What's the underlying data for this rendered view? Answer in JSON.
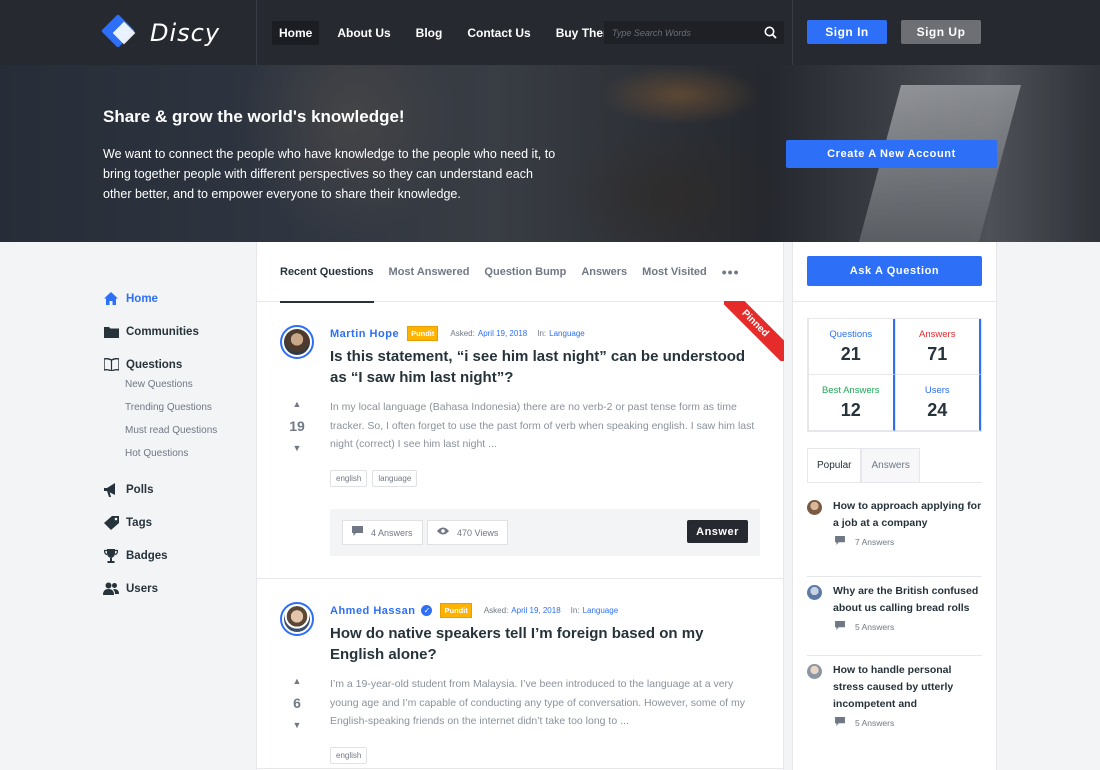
{
  "header": {
    "logo_text": "Discy",
    "nav": [
      "Home",
      "About Us",
      "Blog",
      "Contact Us",
      "Buy Theme"
    ],
    "search_placeholder": "Type Search Words",
    "sign_in": "Sign In",
    "sign_up": "Sign Up"
  },
  "hero": {
    "title": "Share & grow the world's knowledge!",
    "description": "We want to connect the people who have knowledge to the people who need it, to bring together people with different perspectives so they can understand each other better, and to empower everyone to share their knowledge.",
    "cta": "Create A New Account"
  },
  "left_nav": {
    "home": "Home",
    "communities": "Communities",
    "questions": "Questions",
    "sub": [
      "New Questions",
      "Trending Questions",
      "Must read Questions",
      "Hot Questions"
    ],
    "polls": "Polls",
    "tags": "Tags",
    "badges": "Badges",
    "users": "Users"
  },
  "tabs": [
    "Recent Questions",
    "Most Answered",
    "Question Bump",
    "Answers",
    "Most Visited"
  ],
  "tabs_more": "•••",
  "questions": [
    {
      "pinned": "Pinned",
      "author": "Martin Hope",
      "badge": "Pundit",
      "asked_label": "Asked:",
      "date": "April 19, 2018",
      "in_label": "In:",
      "category": "Language",
      "title": "Is this statement, “i see him last night” can be understood as “I saw him last night”?",
      "votes": "19",
      "excerpt": "In my local language (Bahasa Indonesia) there are no verb-2 or past tense form as time tracker. So, I often forget to use the past form of verb when speaking english. I saw him last night (correct) I see him last night ...",
      "tags": [
        "english",
        "language"
      ],
      "answers": "4 Answers",
      "views": "470 Views",
      "answer_button": "Answer"
    },
    {
      "author": "Ahmed Hassan",
      "badge": "Pundit",
      "asked_label": "Asked:",
      "date": "April 19, 2018",
      "in_label": "In:",
      "category": "Language",
      "title": "How do native speakers tell I’m foreign based on my English alone?",
      "votes": "6",
      "excerpt": "I’m a 19-year-old student from Malaysia. I’ve been introduced to the language at a very young age and I’m capable of conducting any type of conversation. However, some of my English-speaking friends on the internet didn’t take too long to ...",
      "tags": [
        "english"
      ]
    }
  ],
  "right": {
    "ask": "Ask A Question",
    "stats": [
      {
        "label": "Questions",
        "value": "21"
      },
      {
        "label": "Answers",
        "value": "71"
      },
      {
        "label": "Best Answers",
        "value": "12"
      },
      {
        "label": "Users",
        "value": "24"
      }
    ],
    "tabs": [
      "Popular",
      "Answers"
    ],
    "popular": [
      {
        "title": "How to approach applying for a job at a company",
        "answers": "7 Answers"
      },
      {
        "title": "Why are the British confused about us calling bread rolls",
        "answers": "5 Answers"
      },
      {
        "title": "How to handle personal stress caused by utterly incompetent and",
        "answers": "5 Answers"
      }
    ]
  },
  "colors": {
    "accent": "#2d6ff7",
    "header_bg": "#272930",
    "badge": "#ffb300",
    "pinned": "#e62b2b"
  }
}
